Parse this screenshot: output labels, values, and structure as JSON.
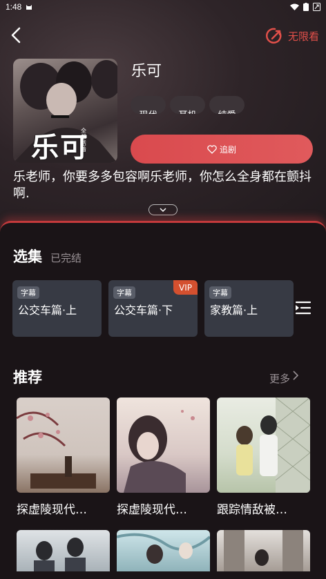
{
  "status_bar": {
    "time": "1:48"
  },
  "header": {
    "unlimited_label": "无限看"
  },
  "drama": {
    "title": "乐可",
    "cover_title_art": "乐可",
    "cover_sub_art": "全都活着",
    "tags": [
      "现代",
      "耳机",
      "纯爱"
    ],
    "follow_label": "追剧",
    "synopsis": "乐老师，你要多多包容啊乐老师，你怎么全身都在颤抖啊."
  },
  "episodes": {
    "title": "选集",
    "status": "已完结",
    "items": [
      {
        "badge": "字幕",
        "name": "公交车篇·上",
        "vip": ""
      },
      {
        "badge": "字幕",
        "name": "公交车篇·下",
        "vip": "VIP"
      },
      {
        "badge": "字幕",
        "name": "家教篇·上",
        "vip": ""
      }
    ]
  },
  "recommend": {
    "title": "推荐",
    "more_label": "更多",
    "items": [
      {
        "title": "探虚陵现代…"
      },
      {
        "title": "探虚陵现代…"
      },
      {
        "title": "跟踪情敌被…"
      }
    ]
  },
  "colors": {
    "accent": "#e2504a",
    "follow_button": "#d94a4e",
    "episode_card": "#373a44",
    "vip_badge": "#d4502f"
  },
  "icons": {
    "back": "chevron-left-icon",
    "unlimited": "no-limit-icon",
    "follow": "heart-icon",
    "expand": "chevron-down-icon",
    "episode_list": "list-icon",
    "more": "chevron-right-icon"
  }
}
